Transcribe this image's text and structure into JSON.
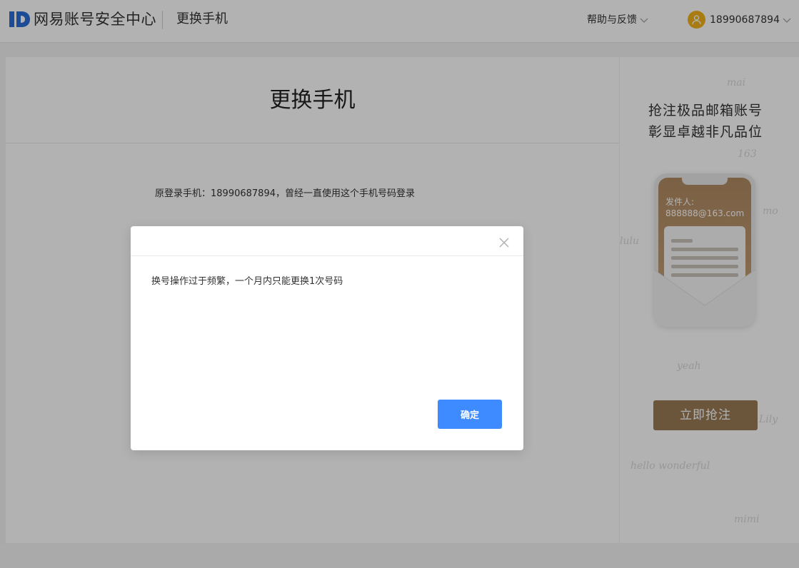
{
  "header": {
    "logo_text": "网易账号安全中心",
    "subtitle": "更换手机",
    "help_label": "帮助与反馈",
    "user_phone": "18990687894"
  },
  "main": {
    "title": "更换手机",
    "original_phone_text": "原登录手机：18990687894，曾经一直使用这个手机号码登录"
  },
  "ad": {
    "title_line1": "抢注极品邮箱账号",
    "title_line2": "彰显卓越非凡品位",
    "sender_label": "发件人:",
    "sender_email": "888888@163.com",
    "cta_label": "立即抢注"
  },
  "modal": {
    "message": "换号操作过于频繁，一个月内只能更换1次号码",
    "confirm_label": "确定"
  },
  "icons": {
    "logo": "id-logo-icon",
    "help_chevron": "chevron-down-icon",
    "user_chevron": "chevron-down-icon",
    "avatar": "user-avatar-icon",
    "close": "close-icon"
  },
  "colors": {
    "brand_blue": "#2b6cd6",
    "confirm_blue": "#3d8bff",
    "avatar_yellow": "#f3b21b",
    "ad_gold": "#9a7b56"
  }
}
